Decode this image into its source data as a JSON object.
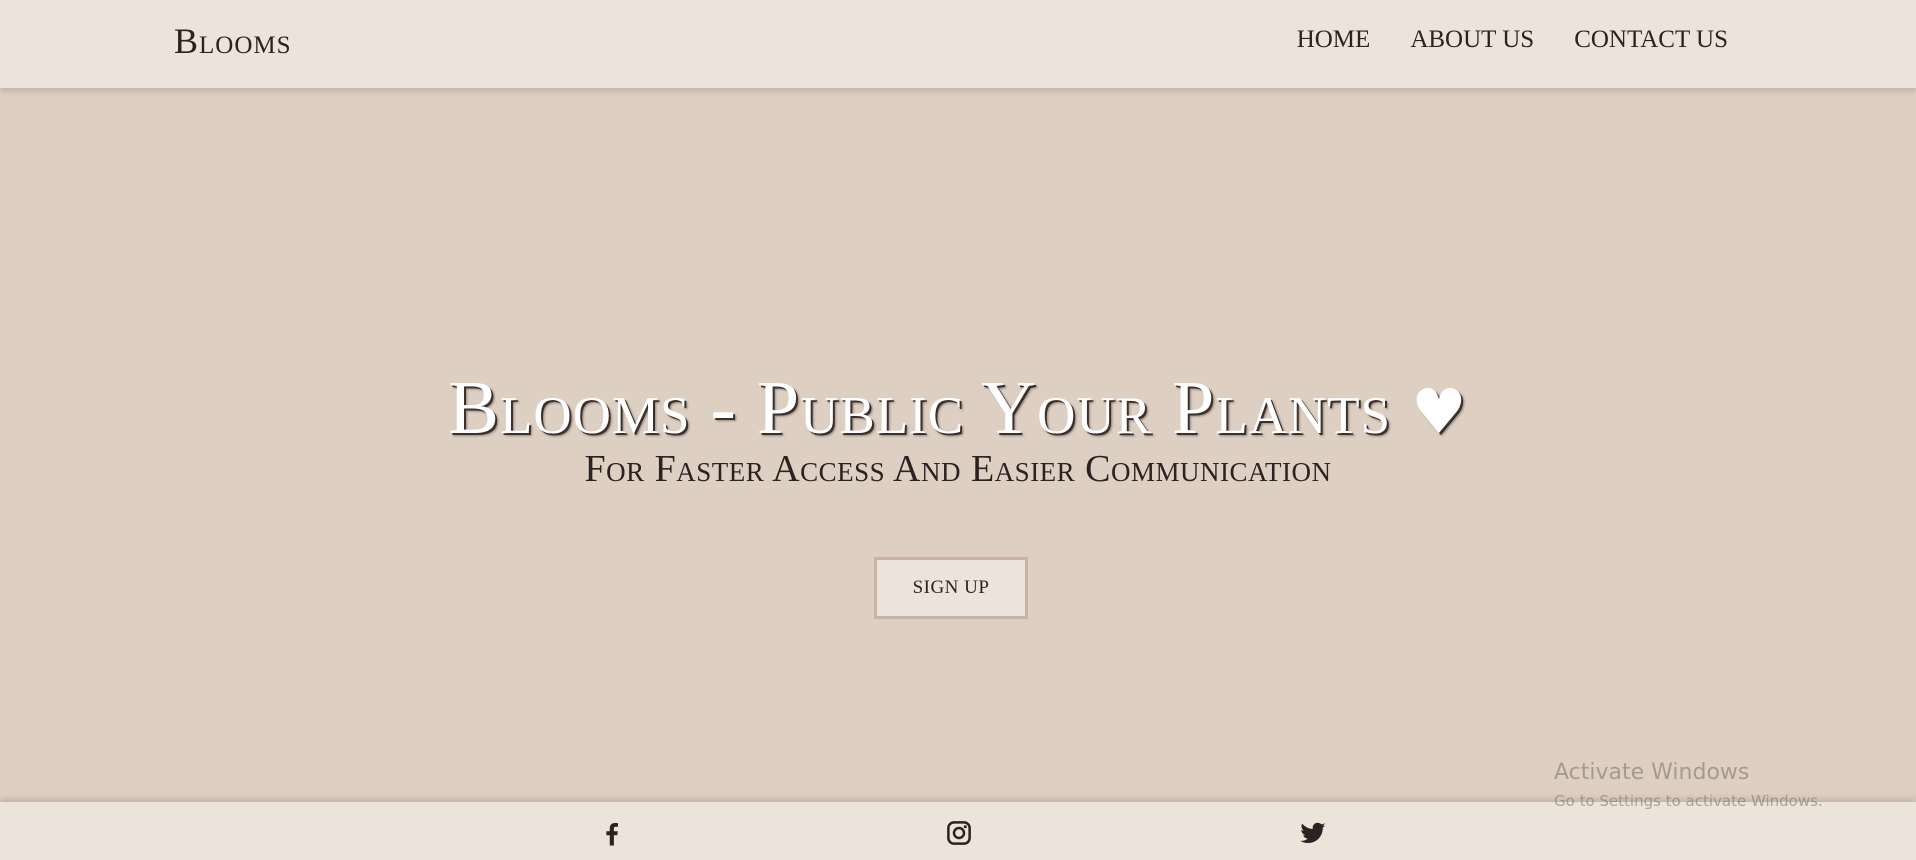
{
  "header": {
    "brand": "Blooms",
    "nav": [
      "HOME",
      "ABOUT US",
      "CONTACT US"
    ]
  },
  "hero": {
    "title": "Blooms - Public Your Plants",
    "title_symbol": "♥",
    "subtitle": "For Faster Access And Easier Communication",
    "cta_label": "SIGN UP"
  },
  "footer": {
    "social_icons": [
      "facebook-icon",
      "instagram-icon",
      "twitter-icon"
    ]
  },
  "watermark": {
    "title": "Activate Windows",
    "subtitle": "Go to Settings to activate Windows."
  },
  "colors": {
    "header_bg": "#ece3da",
    "hero_bg": "#decfc3",
    "text": "#2b2322",
    "button_border": "#c9b3a6"
  }
}
